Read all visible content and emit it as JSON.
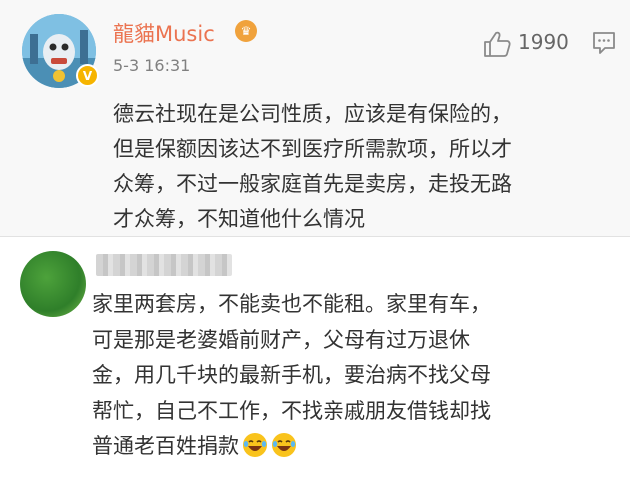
{
  "comments": [
    {
      "username": "龍貓Music",
      "verified_badge": "V",
      "member_badge_icon": "crown-icon",
      "timestamp": "5-3 16:31",
      "like_count": "1990",
      "text_lines": [
        "德云社现在是公司性质，应该是有保险的，",
        "但是保额因该达不到医疗所需款项，所以才",
        "众筹，不过一般家庭首先是卖房，走投无路",
        "才众筹，不知道他什么情况"
      ]
    },
    {
      "text_lines": [
        "家里两套房，不能卖也不能租。家里有车，",
        "可是那是老婆婚前财产，父母有过万退休",
        "金，用几千块的最新手机，要治病不找父母",
        "帮忙，自己不工作，不找亲戚朋友借钱却找",
        "普通老百姓捐款"
      ],
      "emojis": [
        "laughing-crying-emoji",
        "laughing-crying-emoji"
      ]
    }
  ],
  "colors": {
    "username": "#eb7350",
    "text": "#333333",
    "meta": "#808080",
    "first_comment_bg": "#f8f8f8",
    "emoji": "#f9c31c"
  }
}
